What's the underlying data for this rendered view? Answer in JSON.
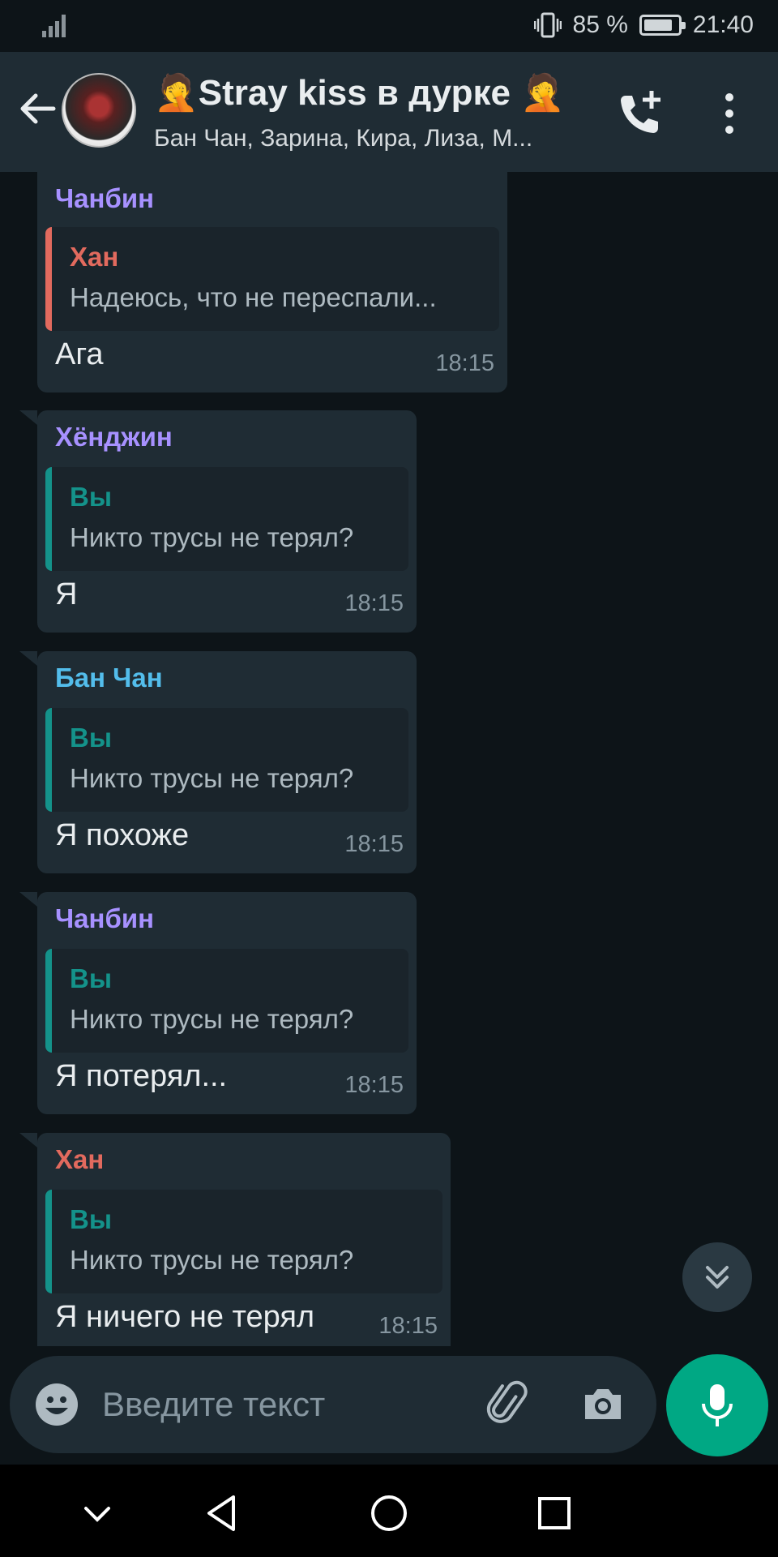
{
  "status_bar": {
    "battery": "85 %",
    "battery_level": 0.85,
    "time": "21:40"
  },
  "header": {
    "title": "🤦Stray kiss в дурке 🤦",
    "subtitle": "Бан Чан, Зарина, Кира, Лиза, М..."
  },
  "colors": {
    "purple": "#a791ff",
    "red": "#e26a5e",
    "cyan": "#53bdeb",
    "teal": "#00a884",
    "bubble": "#1f2c34"
  },
  "messages": [
    {
      "sender": "Чанбин",
      "sender_color": "#a791ff",
      "quote_name": "Хан",
      "quote_color": "#e26a5e",
      "quote_text": "Надеюсь, что не переспали...",
      "text": "Ага",
      "time": "18:15"
    },
    {
      "sender": "Хёнджин",
      "sender_color": "#a791ff",
      "quote_name": "Вы",
      "quote_color": "#14928a",
      "quote_text": "Никто трусы не терял?",
      "text": "Я",
      "time": "18:15"
    },
    {
      "sender": "Бан Чан",
      "sender_color": "#53bdeb",
      "quote_name": "Вы",
      "quote_color": "#14928a",
      "quote_text": "Никто трусы не терял?",
      "text": "Я похоже",
      "time": "18:15"
    },
    {
      "sender": "Чанбин",
      "sender_color": "#a791ff",
      "quote_name": "Вы",
      "quote_color": "#14928a",
      "quote_text": "Никто трусы не терял?",
      "text": "Я потерял...",
      "time": "18:15"
    },
    {
      "sender": "Хан",
      "sender_color": "#e26a5e",
      "quote_name": "Вы",
      "quote_color": "#14928a",
      "quote_text": "Никто трусы не терял?",
      "text": "Я ничего не терял",
      "time": "18:15"
    }
  ],
  "input": {
    "placeholder": "Введите текст"
  },
  "icons": {
    "back": "back-arrow-icon",
    "call": "add-call-icon",
    "menu": "more-vertical-icon",
    "scroll": "double-chevron-down-icon",
    "emoji": "emoji-icon",
    "attach": "paperclip-icon",
    "camera": "camera-icon",
    "mic": "microphone-icon"
  }
}
